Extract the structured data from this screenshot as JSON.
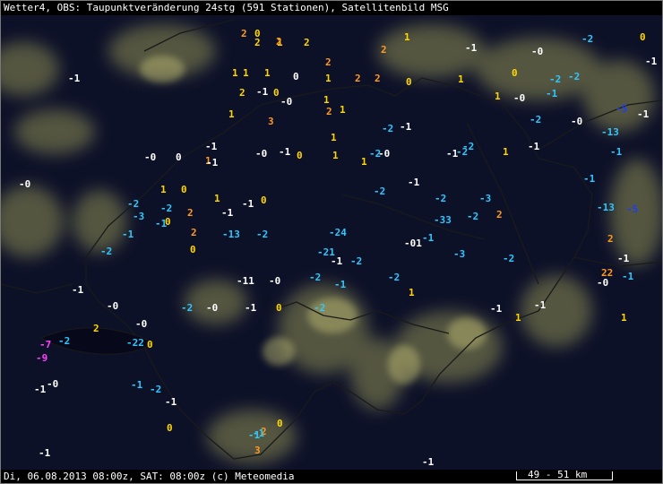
{
  "header": {
    "title": "Wetter4, OBS: Taupunktveränderung 24stg (591 Stationen), Satellitenbild MSG"
  },
  "footer": {
    "timestamp": "Di, 06.08.2013 08:00z, SAT: 08:00z (c) Meteomedia",
    "scale_label": "49 - 51 km"
  },
  "colors": {
    "white": "#ffffff",
    "yellow": "#ffd700",
    "orange": "#ff9a1f",
    "cyan": "#2ec8ff",
    "blue": "#1a3cff",
    "magenta": "#ff40ff",
    "background": "#0d1128",
    "cloud": "#9a9a5a",
    "border": "#1c1c1c"
  },
  "observations": [
    {
      "v": "2",
      "c": "orange"
    },
    {
      "v": "0",
      "c": "yellow"
    },
    {
      "v": "2",
      "c": "yellow"
    },
    {
      "v": "1",
      "c": "yellow"
    },
    {
      "v": "2",
      "c": "yellow"
    },
    {
      "v": "2",
      "c": "orange"
    },
    {
      "v": "1",
      "c": "yellow"
    },
    {
      "v": "-2",
      "c": "cyan"
    },
    {
      "v": "0",
      "c": "yellow"
    },
    {
      "v": "-1",
      "c": "white"
    },
    {
      "v": "-0",
      "c": "white"
    },
    {
      "v": "-1",
      "c": "white"
    },
    {
      "v": "2",
      "c": "orange"
    },
    {
      "v": "1",
      "c": "yellow"
    },
    {
      "v": "0",
      "c": "white"
    },
    {
      "v": "-0",
      "c": "white"
    },
    {
      "v": "2",
      "c": "orange"
    },
    {
      "v": "1",
      "c": "yellow"
    },
    {
      "v": "0",
      "c": "yellow"
    },
    {
      "v": "-2",
      "c": "cyan"
    },
    {
      "v": "-2",
      "c": "cyan"
    },
    {
      "v": "-1",
      "c": "white"
    },
    {
      "v": "1",
      "c": "yellow"
    },
    {
      "v": "1",
      "c": "yellow"
    },
    {
      "v": "-1",
      "c": "white"
    },
    {
      "v": "2",
      "c": "yellow"
    },
    {
      "v": "0",
      "c": "yellow"
    },
    {
      "v": "2",
      "c": "orange"
    },
    {
      "v": "2",
      "c": "orange"
    },
    {
      "v": "1",
      "c": "yellow"
    },
    {
      "v": "0",
      "c": "yellow"
    },
    {
      "v": "1",
      "c": "yellow"
    },
    {
      "v": "-1",
      "c": "cyan"
    },
    {
      "v": "-5",
      "c": "blue"
    },
    {
      "v": "-1",
      "c": "white"
    },
    {
      "v": "1",
      "c": "yellow"
    },
    {
      "v": "3",
      "c": "orange"
    },
    {
      "v": "2",
      "c": "orange"
    },
    {
      "v": "1",
      "c": "yellow"
    },
    {
      "v": "-2",
      "c": "cyan"
    },
    {
      "v": "-1",
      "c": "white"
    },
    {
      "v": "1",
      "c": "yellow"
    },
    {
      "v": "-0",
      "c": "white"
    },
    {
      "v": "-2",
      "c": "cyan"
    },
    {
      "v": "-0",
      "c": "white"
    },
    {
      "v": "-13",
      "c": "cyan"
    },
    {
      "v": "-1",
      "c": "white"
    },
    {
      "v": "-0",
      "c": "white"
    },
    {
      "v": "0",
      "c": "white"
    },
    {
      "v": "1",
      "c": "orange"
    },
    {
      "v": "1",
      "c": "yellow"
    },
    {
      "v": "-0",
      "c": "white"
    },
    {
      "v": "-1",
      "c": "white"
    },
    {
      "v": "-2",
      "c": "cyan"
    },
    {
      "v": "-0",
      "c": "white"
    },
    {
      "v": "-2",
      "c": "cyan"
    },
    {
      "v": "-1",
      "c": "white"
    },
    {
      "v": "-1",
      "c": "cyan"
    },
    {
      "v": "-0",
      "c": "white"
    },
    {
      "v": "1",
      "c": "yellow"
    },
    {
      "v": "-1",
      "c": "white"
    },
    {
      "v": "1",
      "c": "yellow"
    },
    {
      "v": "0",
      "c": "yellow"
    },
    {
      "v": "1",
      "c": "yellow"
    },
    {
      "v": "-1",
      "c": "white"
    },
    {
      "v": "-2",
      "c": "cyan"
    },
    {
      "v": "1",
      "c": "yellow"
    },
    {
      "v": "-1",
      "c": "cyan"
    },
    {
      "v": "-2",
      "c": "cyan"
    },
    {
      "v": "0",
      "c": "yellow"
    },
    {
      "v": "1",
      "c": "yellow"
    },
    {
      "v": "-1",
      "c": "white"
    },
    {
      "v": "0",
      "c": "yellow"
    },
    {
      "v": "-2",
      "c": "cyan"
    },
    {
      "v": "-1",
      "c": "white"
    },
    {
      "v": "-2",
      "c": "cyan"
    },
    {
      "v": "-3",
      "c": "cyan"
    },
    {
      "v": "-13",
      "c": "cyan"
    },
    {
      "v": "-5",
      "c": "blue"
    },
    {
      "v": "-3",
      "c": "cyan"
    },
    {
      "v": "-1",
      "c": "cyan"
    },
    {
      "v": "0",
      "c": "yellow"
    },
    {
      "v": "-2",
      "c": "cyan"
    },
    {
      "v": "2",
      "c": "orange"
    },
    {
      "v": "-1",
      "c": "white"
    },
    {
      "v": "-33",
      "c": "cyan"
    },
    {
      "v": "-2",
      "c": "cyan"
    },
    {
      "v": "2",
      "c": "orange"
    },
    {
      "v": "-1",
      "c": "cyan"
    },
    {
      "v": "2",
      "c": "orange"
    },
    {
      "v": "-13",
      "c": "cyan"
    },
    {
      "v": "-2",
      "c": "cyan"
    },
    {
      "v": "-24",
      "c": "cyan"
    },
    {
      "v": "-01",
      "c": "white"
    },
    {
      "v": "-1",
      "c": "cyan"
    },
    {
      "v": "2",
      "c": "orange"
    },
    {
      "v": "-1",
      "c": "white"
    },
    {
      "v": "-2",
      "c": "cyan"
    },
    {
      "v": "0",
      "c": "yellow"
    },
    {
      "v": "-21",
      "c": "cyan"
    },
    {
      "v": "-1",
      "c": "white"
    },
    {
      "v": "-2",
      "c": "cyan"
    },
    {
      "v": "-3",
      "c": "cyan"
    },
    {
      "v": "-2",
      "c": "cyan"
    },
    {
      "v": "22",
      "c": "orange"
    },
    {
      "v": "-1",
      "c": "cyan"
    },
    {
      "v": "-1",
      "c": "white"
    },
    {
      "v": "-0",
      "c": "white"
    },
    {
      "v": "-11",
      "c": "white"
    },
    {
      "v": "-0",
      "c": "white"
    },
    {
      "v": "-2",
      "c": "cyan"
    },
    {
      "v": "-1",
      "c": "cyan"
    },
    {
      "v": "-2",
      "c": "cyan"
    },
    {
      "v": "1",
      "c": "yellow"
    },
    {
      "v": "-0",
      "c": "white"
    },
    {
      "v": "-2",
      "c": "cyan"
    },
    {
      "v": "-0",
      "c": "white"
    },
    {
      "v": "-1",
      "c": "white"
    },
    {
      "v": "0",
      "c": "yellow"
    },
    {
      "v": "-2",
      "c": "cyan"
    },
    {
      "v": "-1",
      "c": "white"
    },
    {
      "v": "1",
      "c": "yellow"
    },
    {
      "v": "-1",
      "c": "white"
    },
    {
      "v": "1",
      "c": "yellow"
    },
    {
      "v": "-7",
      "c": "magenta"
    },
    {
      "v": "-9",
      "c": "magenta"
    },
    {
      "v": "-2",
      "c": "cyan"
    },
    {
      "v": "2",
      "c": "yellow"
    },
    {
      "v": "-0",
      "c": "white"
    },
    {
      "v": "-22",
      "c": "cyan"
    },
    {
      "v": "0",
      "c": "yellow"
    },
    {
      "v": "-0",
      "c": "white"
    },
    {
      "v": "-1",
      "c": "white"
    },
    {
      "v": "-1",
      "c": "cyan"
    },
    {
      "v": "-2",
      "c": "cyan"
    },
    {
      "v": "-1",
      "c": "white"
    },
    {
      "v": "0",
      "c": "yellow"
    },
    {
      "v": "-1",
      "c": "white"
    },
    {
      "v": "3",
      "c": "orange"
    },
    {
      "v": "2",
      "c": "orange"
    },
    {
      "v": "-1",
      "c": "cyan"
    },
    {
      "v": "0",
      "c": "yellow"
    },
    {
      "v": "-1",
      "c": "cyan"
    },
    {
      "v": "-1",
      "c": "white"
    }
  ]
}
